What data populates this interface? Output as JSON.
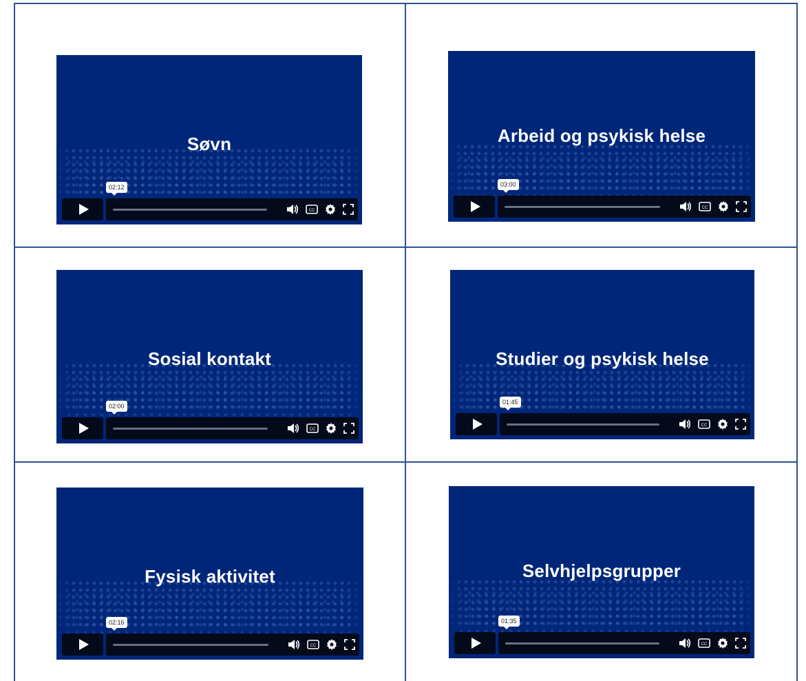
{
  "videos": [
    {
      "title": "Søvn",
      "time": "02:12"
    },
    {
      "title": "Arbeid og psykisk helse",
      "time": "03:00"
    },
    {
      "title": "Sosial kontakt",
      "time": "02:00"
    },
    {
      "title": "Studier og psykisk helse",
      "time": "01:45"
    },
    {
      "title": "Fysisk aktivitet",
      "time": "02:16"
    },
    {
      "title": "Selvhjelpsgrupper",
      "time": "01:35"
    }
  ],
  "colors": {
    "player_bg": "#00267a",
    "control_bg": "#040a1a",
    "grid_line": "#2b5190"
  },
  "icons": [
    "play-icon",
    "volume-icon",
    "captions-icon",
    "settings-icon",
    "fullscreen-icon"
  ]
}
